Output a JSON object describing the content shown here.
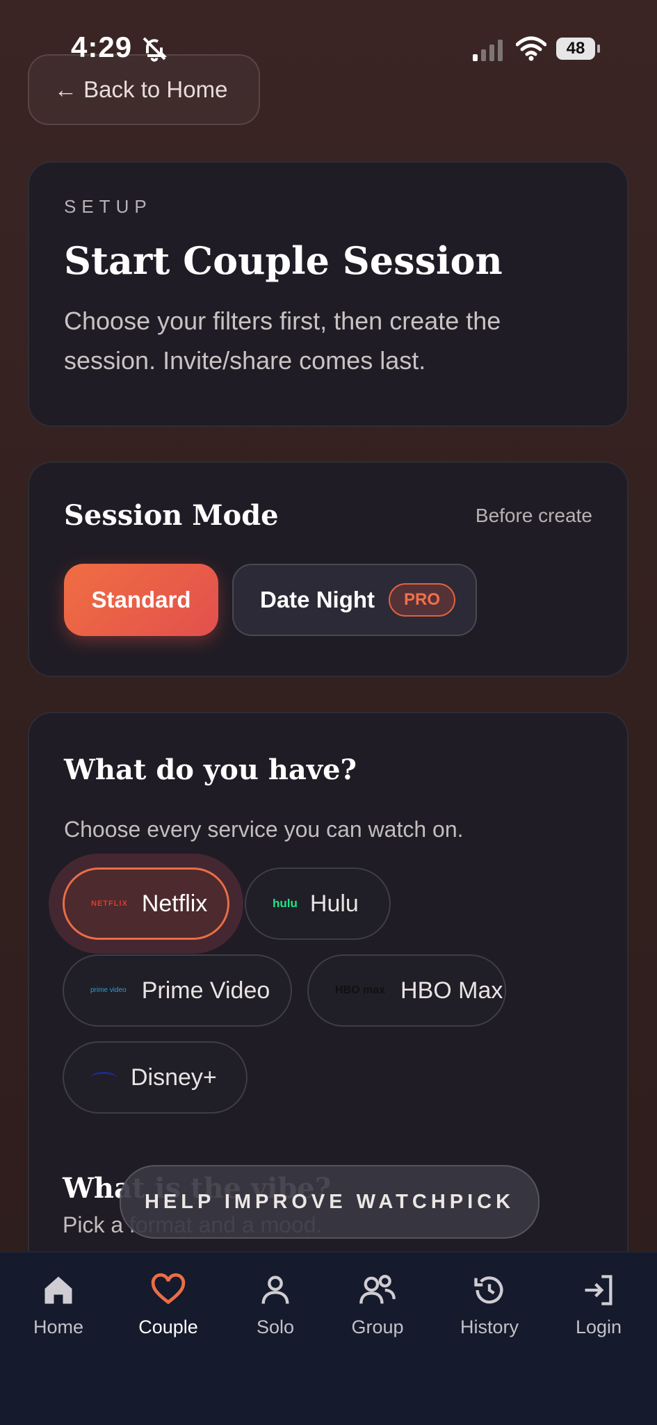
{
  "status": {
    "time": "4:29",
    "battery": "48"
  },
  "nav": {
    "back_label": "← Back to Home"
  },
  "setup_card": {
    "eyebrow": "SETUP",
    "title": "Start Couple Session",
    "description": "Choose your filters first, then create the session. Invite/share comes last."
  },
  "session_mode": {
    "title": "Session Mode",
    "hint": "Before create",
    "options": [
      {
        "label": "Standard",
        "selected": true
      },
      {
        "label": "Date Night",
        "badge": "PRO",
        "selected": false
      }
    ]
  },
  "services": {
    "title": "What do you have?",
    "help": "Choose every service you can watch on.",
    "items": [
      {
        "label": "Netflix",
        "logo": "NETFLIX",
        "selected": true
      },
      {
        "label": "Hulu",
        "logo": "hulu",
        "selected": false
      },
      {
        "label": "Prime Video",
        "logo": "prime video",
        "selected": false
      },
      {
        "label": "HBO Max",
        "logo": "HBO max",
        "selected": false
      },
      {
        "label": "Disney+",
        "logo": "disney",
        "selected": false
      }
    ]
  },
  "vibe": {
    "title": "What is the vibe?",
    "subtitle": "Pick a format and a mood."
  },
  "feedback_pill": "HELP IMPROVE WATCHPICK",
  "tabbar": {
    "items": [
      {
        "label": "Home",
        "icon": "home-icon"
      },
      {
        "label": "Couple",
        "icon": "heart-icon",
        "active": true
      },
      {
        "label": "Solo",
        "icon": "person-icon"
      },
      {
        "label": "Group",
        "icon": "group-icon"
      },
      {
        "label": "History",
        "icon": "history-icon"
      },
      {
        "label": "Login",
        "icon": "login-icon"
      }
    ]
  },
  "colors": {
    "accent": "#ea6e45",
    "tabbar_bg": "#151a2c",
    "card_bg": "#1e1c26"
  }
}
